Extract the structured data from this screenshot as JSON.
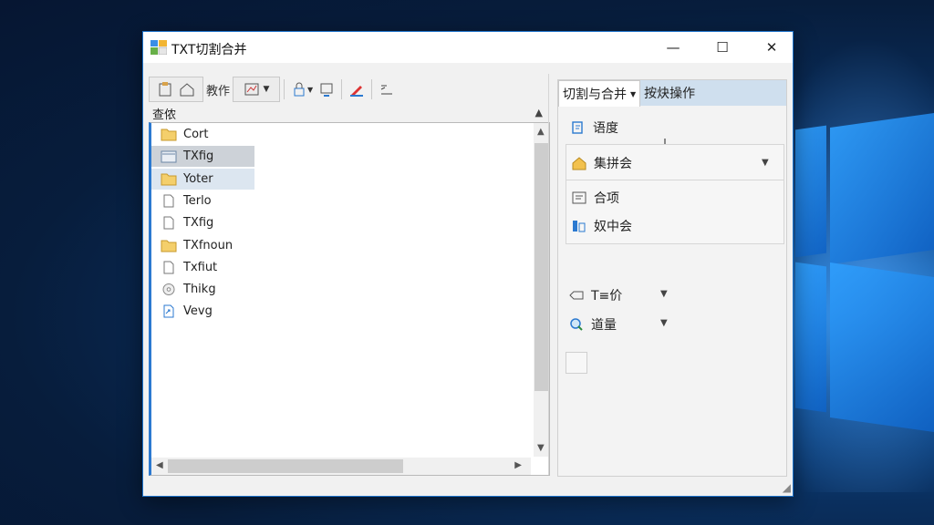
{
  "window": {
    "title": "TXT切割合并",
    "minimize": "—",
    "maximize": "☐",
    "close": "✕"
  },
  "toolbar": {
    "items": [
      "教作"
    ]
  },
  "left_panel": {
    "path_label": "查侬",
    "files": [
      {
        "name": "Cort",
        "icon": "folder-icon"
      },
      {
        "name": "TXfig",
        "icon": "folder-open-icon"
      },
      {
        "name": "Yoter",
        "icon": "folder-icon"
      },
      {
        "name": "Terlo",
        "icon": "file-icon"
      },
      {
        "name": "TXfig",
        "icon": "file-icon"
      },
      {
        "name": "TXfnoun",
        "icon": "folder-icon"
      },
      {
        "name": "Txfiut",
        "icon": "file-icon"
      },
      {
        "name": "Thikg",
        "icon": "disc-icon"
      },
      {
        "name": "Vevg",
        "icon": "shortcut-file-icon"
      }
    ]
  },
  "right_panel": {
    "tab_active": "切割与合并",
    "tab_other": "按炔操作",
    "rows": {
      "progress": "语度",
      "merge_set": "集拼会",
      "merge_item": "合项",
      "merge_center": "奴中会",
      "t_option": "T≡价",
      "search": "道量"
    }
  },
  "colors": {
    "accent": "#2b79d0",
    "selected_row": "#cdd2d8",
    "hover_row": "#dce6f0"
  }
}
